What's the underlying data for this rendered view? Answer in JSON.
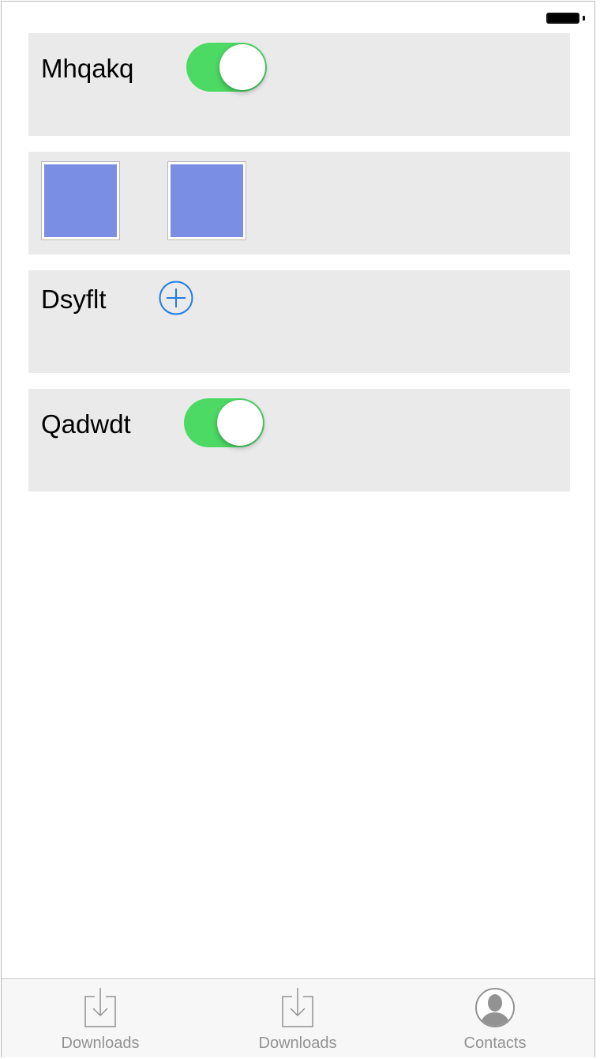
{
  "rows": [
    {
      "label": "Mhqakq",
      "toggle_on": true
    },
    {
      "swatches": [
        "#7a8fe4",
        "#7a8fe4"
      ]
    },
    {
      "label": "Dsyflt",
      "action": "add"
    },
    {
      "label": "Qadwdt",
      "toggle_on": true
    }
  ],
  "colors": {
    "card_background": "#eaeaea",
    "toggle_on": "#4cd964",
    "accent_blue": "#1f7ce6",
    "swatch_fill": "#7a8fe4",
    "tab_inactive": "#929292"
  },
  "tab_bar": {
    "items": [
      {
        "label": "Downloads",
        "icon": "download-tray-icon"
      },
      {
        "label": "Downloads",
        "icon": "download-tray-icon"
      },
      {
        "label": "Contacts",
        "icon": "contact-silhouette-icon"
      }
    ]
  }
}
